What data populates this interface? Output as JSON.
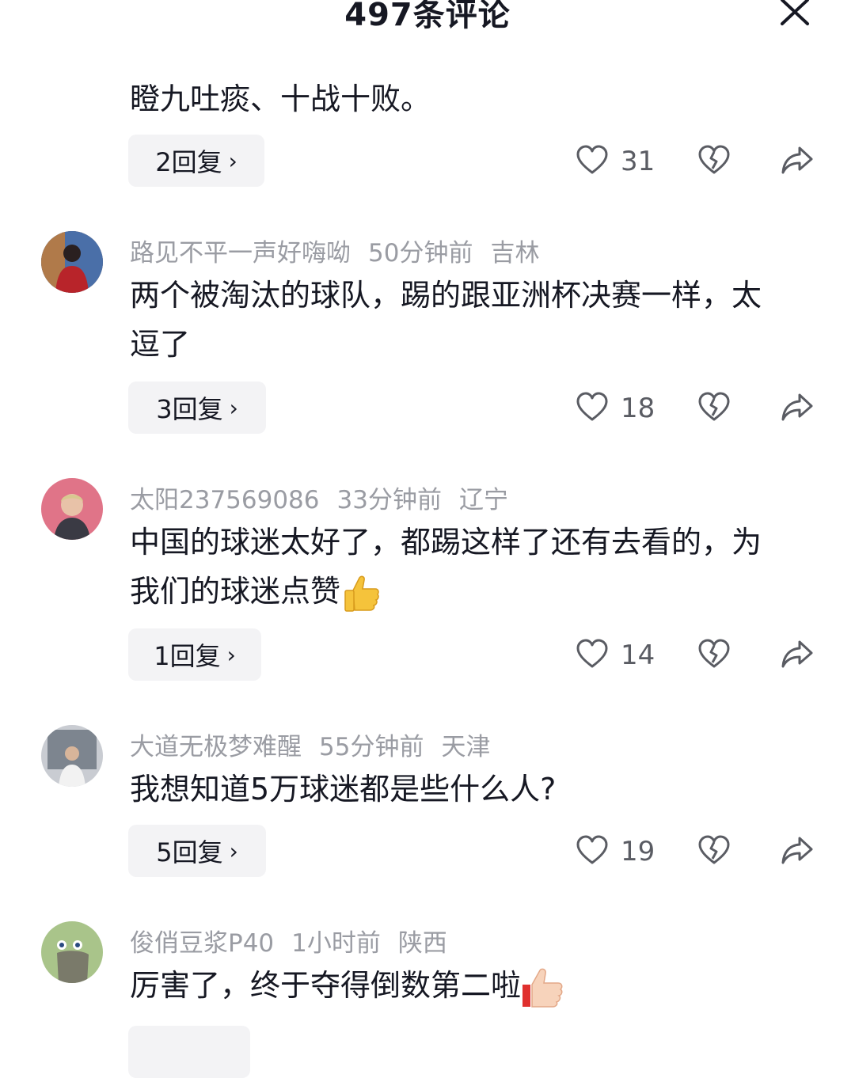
{
  "header": {
    "title": "497条评论"
  },
  "comments": [
    {
      "text": "瞪九吐痰、十战十败。",
      "replies": "2回复",
      "likes": "31"
    },
    {
      "username": "路见不平一声好嗨呦",
      "time": "50分钟前",
      "location": "吉林",
      "text": "两个被淘汰的球队，踢的跟亚洲杯决赛一样，太逗了",
      "replies": "3回复",
      "likes": "18"
    },
    {
      "username": "太阳237569086",
      "time": "33分钟前",
      "location": "辽宁",
      "text": "中国的球迷太好了，都踢这样了还有去看的，为我们的球迷点赞",
      "replies": "1回复",
      "likes": "14"
    },
    {
      "username": "大道无极梦难醒",
      "time": "55分钟前",
      "location": "天津",
      "text": "我想知道5万球迷都是些什么人?",
      "replies": "5回复",
      "likes": "19"
    },
    {
      "username": "俊俏豆浆P40",
      "time": "1小时前",
      "location": "陕西",
      "text": "厉害了，终于夺得倒数第二啦"
    }
  ],
  "colors": {
    "text": "#161823",
    "meta": "#9a9ca3",
    "button_bg": "#f3f3f5",
    "icon": "#5a5c63"
  },
  "icons": [
    "close-icon",
    "heart-icon",
    "broken-heart-icon",
    "share-icon",
    "thumbs-up-emoji"
  ]
}
